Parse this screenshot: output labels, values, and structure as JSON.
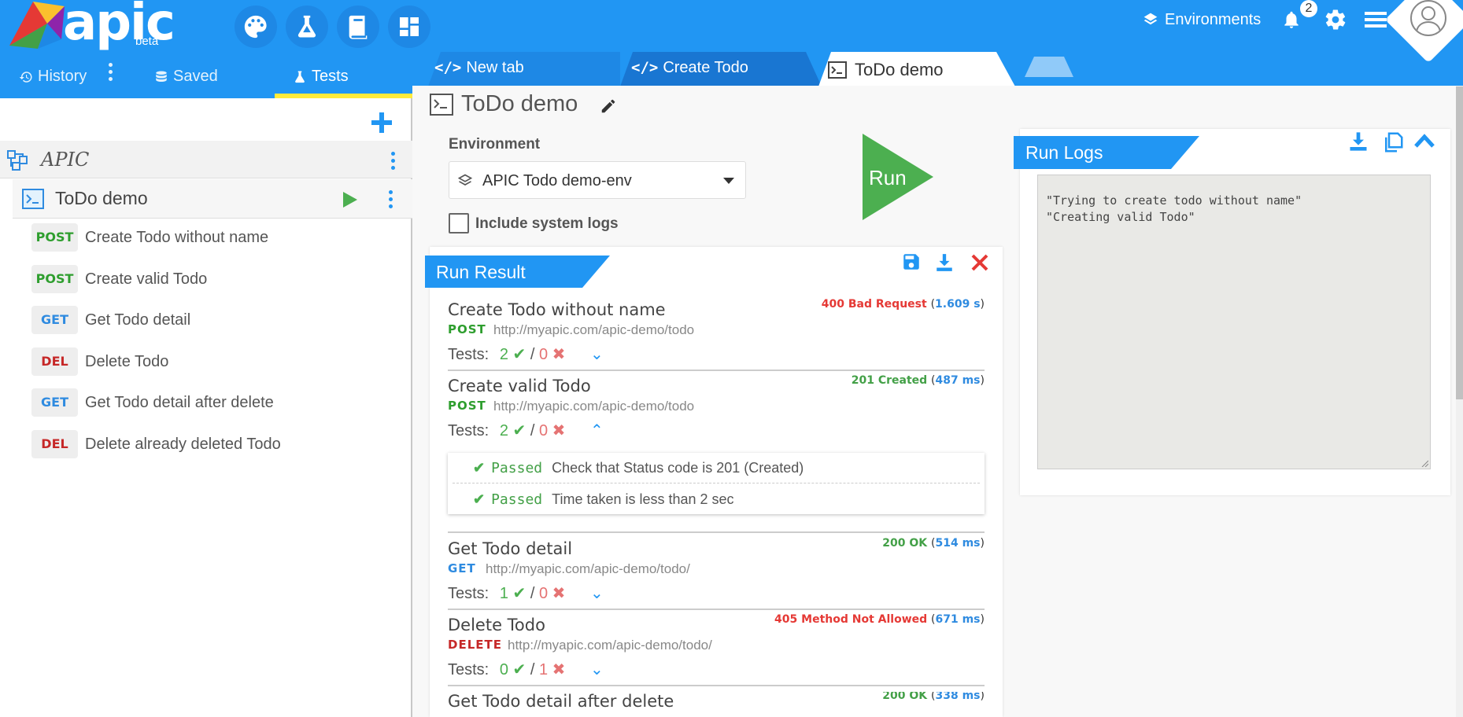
{
  "app": {
    "logo_text": "apic",
    "logo_sub": "beta",
    "environments_label": "Environments",
    "notification_count": "2",
    "colors": {
      "primary": "#2196f3",
      "accent": "#ffeb3b",
      "success": "#4caf50",
      "error": "#e53935"
    }
  },
  "toolbar_icons": [
    "palette-icon",
    "flask-icon",
    "book-icon",
    "dashboard-icon"
  ],
  "left_tabs": [
    {
      "label": "History",
      "icon": "history-icon"
    },
    {
      "label": "Saved",
      "icon": "database-icon"
    },
    {
      "label": "Tests",
      "icon": "flask-icon",
      "active": true
    }
  ],
  "tree": {
    "folder": "APIC",
    "suite": "ToDo demo",
    "requests": [
      {
        "method": "POST",
        "name": "Create Todo without name"
      },
      {
        "method": "POST",
        "name": "Create valid Todo"
      },
      {
        "method": "GET",
        "name": "Get Todo detail"
      },
      {
        "method": "DEL",
        "name": "Delete Todo"
      },
      {
        "method": "GET",
        "name": "Get Todo detail after delete"
      },
      {
        "method": "DEL",
        "name": "Delete already deleted Todo"
      }
    ]
  },
  "tabs": [
    {
      "label": "New tab",
      "icon": "code-icon"
    },
    {
      "label": "Create Todo",
      "icon": "code-icon"
    },
    {
      "label": "ToDo demo",
      "icon": "terminal-icon",
      "active": true
    }
  ],
  "runner": {
    "title": "ToDo demo",
    "environment_label": "Environment",
    "environment_value": "APIC Todo demo-env",
    "include_logs_label": "Include system logs",
    "run_label": "Run"
  },
  "run_result": {
    "title": "Run Result",
    "tests_label": "Tests:",
    "passed_word": "Passed",
    "items": [
      {
        "name": "Create Todo without name",
        "status": "400 Bad Request",
        "time": "1.609 s",
        "method": "POST",
        "url": "http://myapic.com/apic-demo/todo",
        "pass": "2",
        "fail": "0",
        "expanded": false
      },
      {
        "name": "Create valid Todo",
        "status": "201 Created",
        "time": "487 ms",
        "method": "POST",
        "url": "http://myapic.com/apic-demo/todo",
        "pass": "2",
        "fail": "0",
        "expanded": true
      },
      {
        "name": "Get Todo detail",
        "status": "200 OK",
        "time": "514 ms",
        "method": "GET",
        "url": "http://myapic.com/apic-demo/todo/",
        "pass": "1",
        "fail": "0",
        "expanded": false
      },
      {
        "name": "Delete Todo",
        "status": "405 Method Not Allowed",
        "time": "671 ms",
        "method": "DELETE",
        "url": "http://myapic.com/apic-demo/todo/",
        "pass": "0",
        "fail": "1",
        "expanded": false
      },
      {
        "name": "Get Todo detail after delete",
        "status": "200 OK",
        "time": "338 ms"
      }
    ],
    "passed_tests": [
      "Check that Status code is 201 (Created)",
      "Time taken is less than 2 sec"
    ]
  },
  "run_logs": {
    "title": "Run Logs",
    "lines": [
      "\"Trying to create todo without name\"",
      "\"Creating valid Todo\""
    ]
  }
}
